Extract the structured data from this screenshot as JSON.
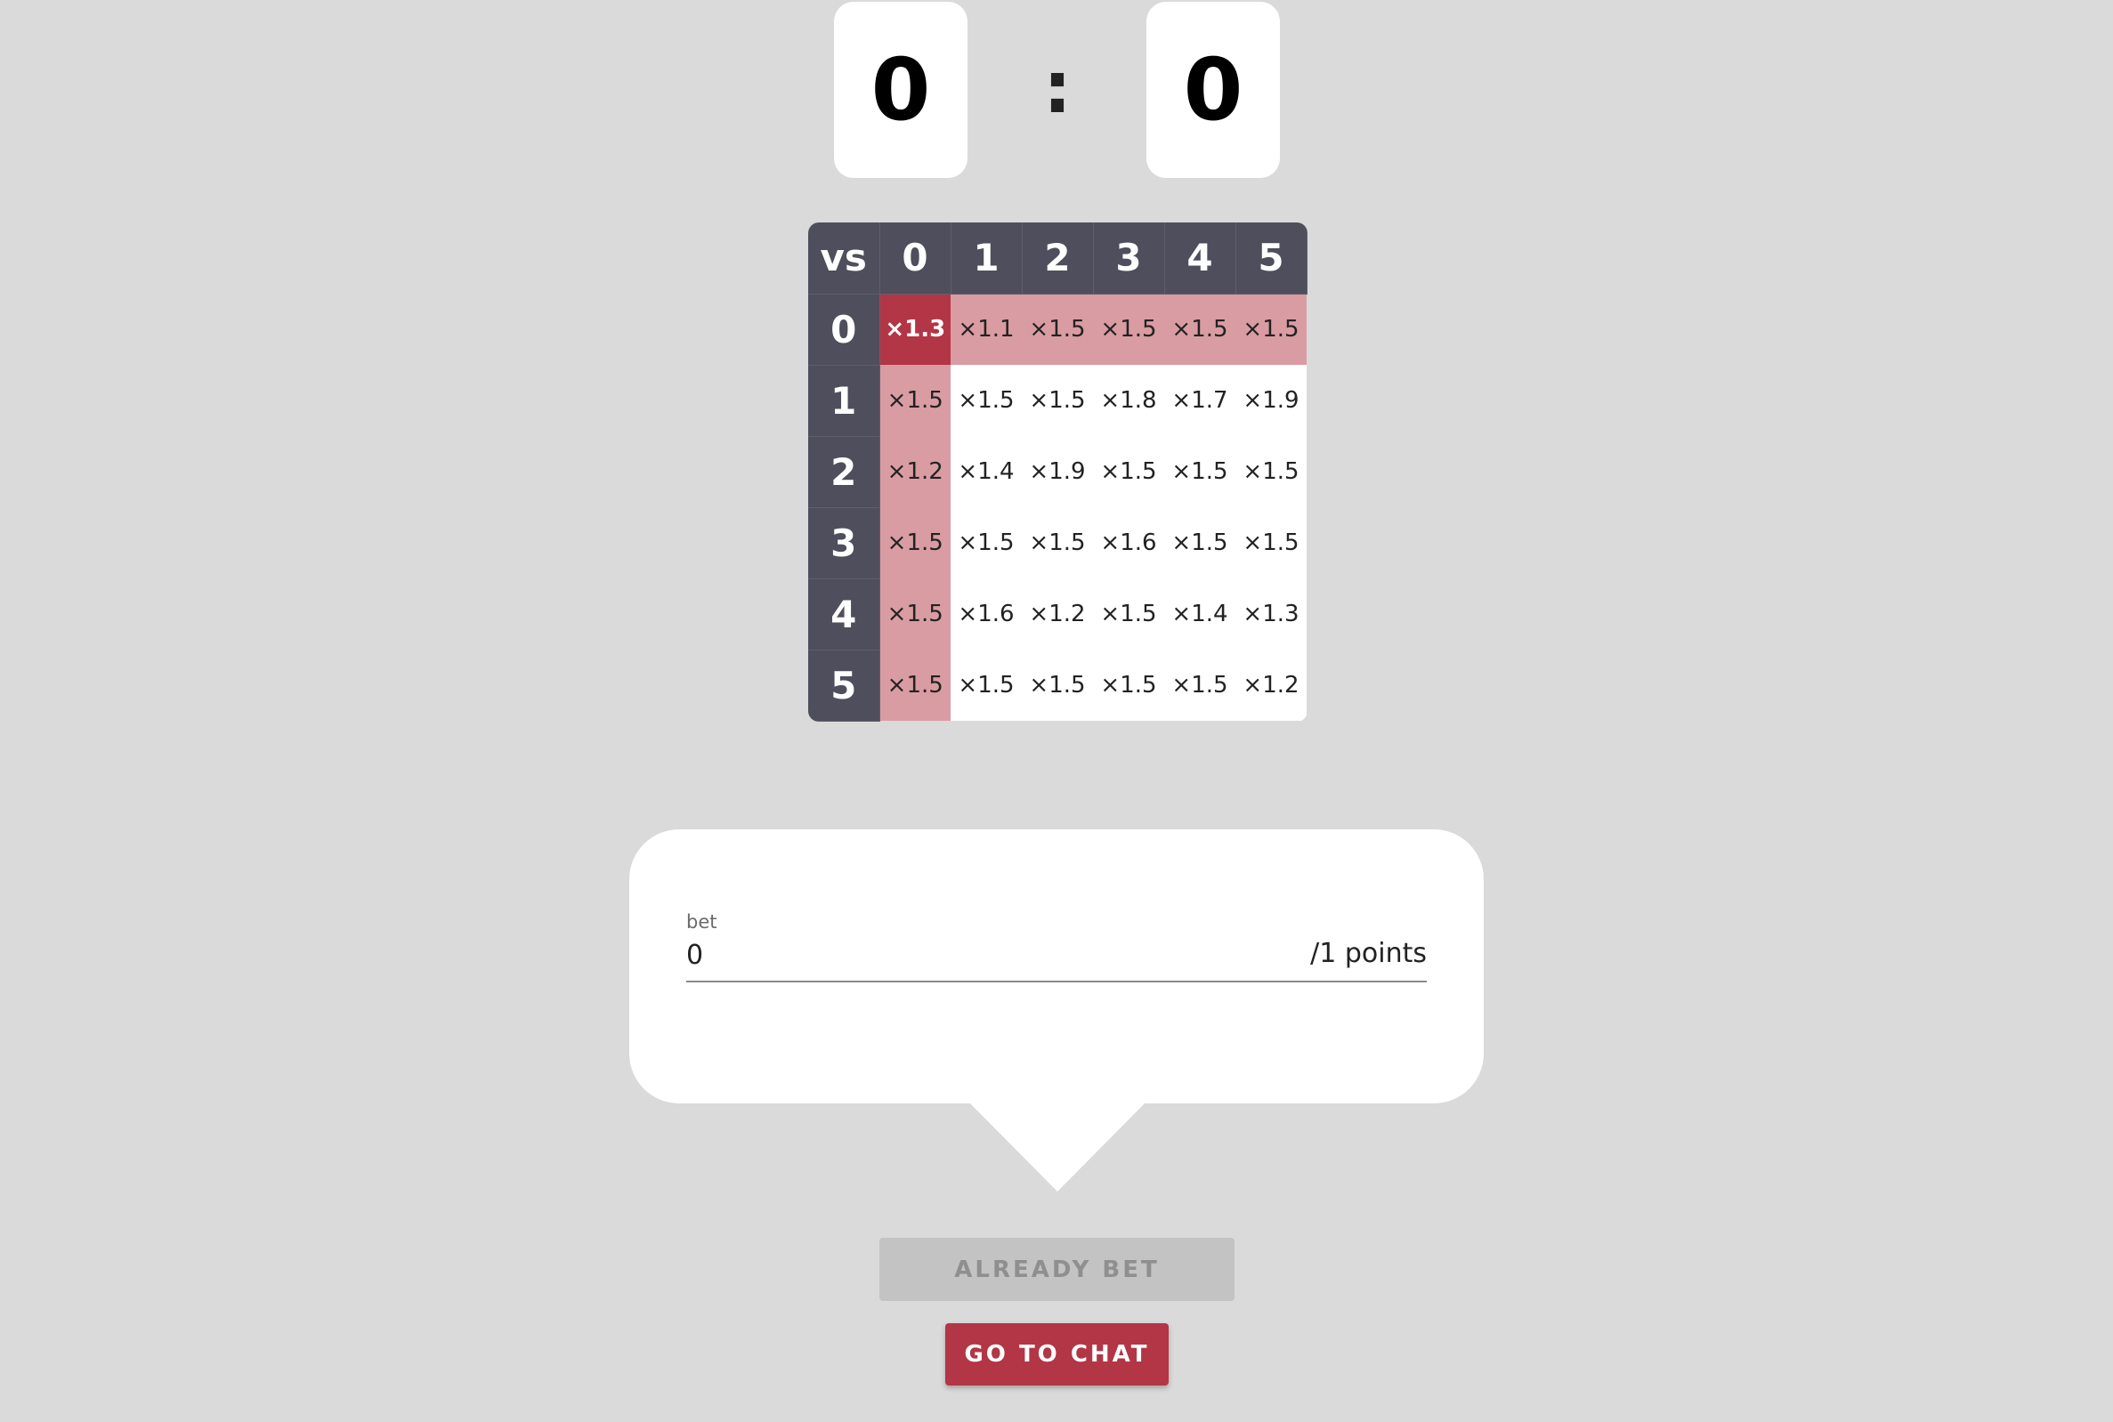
{
  "score": {
    "left": "0",
    "separator": ":",
    "right": "0"
  },
  "odds_table": {
    "corner": "vs",
    "col_headers": [
      "0",
      "1",
      "2",
      "3",
      "4",
      "5"
    ],
    "rows": [
      {
        "header": "0",
        "cells": [
          "×1.3",
          "×1.1",
          "×1.5",
          "×1.5",
          "×1.5",
          "×1.5"
        ]
      },
      {
        "header": "1",
        "cells": [
          "×1.5",
          "×1.5",
          "×1.5",
          "×1.8",
          "×1.7",
          "×1.9"
        ]
      },
      {
        "header": "2",
        "cells": [
          "×1.2",
          "×1.4",
          "×1.9",
          "×1.5",
          "×1.5",
          "×1.5"
        ]
      },
      {
        "header": "3",
        "cells": [
          "×1.5",
          "×1.5",
          "×1.5",
          "×1.6",
          "×1.5",
          "×1.5"
        ]
      },
      {
        "header": "4",
        "cells": [
          "×1.5",
          "×1.6",
          "×1.2",
          "×1.5",
          "×1.4",
          "×1.3"
        ]
      },
      {
        "header": "5",
        "cells": [
          "×1.5",
          "×1.5",
          "×1.5",
          "×1.5",
          "×1.5",
          "×1.2"
        ]
      }
    ]
  },
  "bet": {
    "label": "bet",
    "value": "0",
    "suffix": "/1 points"
  },
  "buttons": {
    "already_bet": "ALREADY BET",
    "go_to_chat": "GO TO CHAT"
  },
  "colors": {
    "background": "#dadada",
    "header_bg": "#4e4e5c",
    "highlight": "#d99ca2",
    "selected": "#b23645",
    "primary_button": "#b23645",
    "disabled_button": "#c3c3c3"
  }
}
